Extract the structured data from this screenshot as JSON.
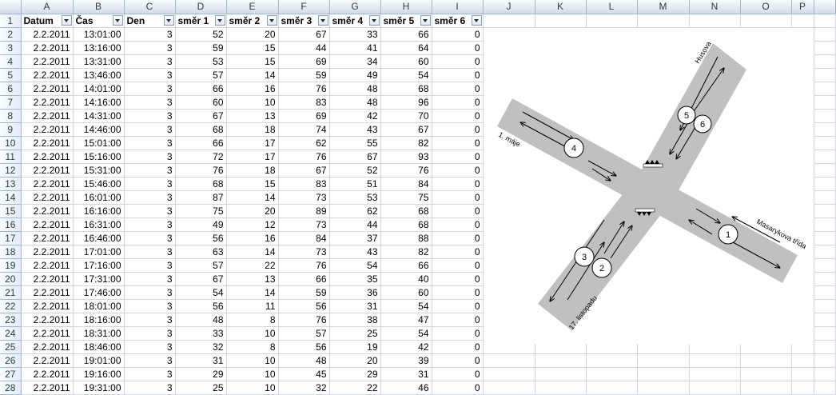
{
  "columns": [
    "A",
    "B",
    "C",
    "D",
    "E",
    "F",
    "G",
    "H",
    "I",
    "J",
    "K",
    "L",
    "M",
    "N",
    "O",
    "P"
  ],
  "headers": [
    "Datum",
    "Čas",
    "Den",
    "směr 1",
    "směr 2",
    "směr 3",
    "směr 4",
    "směr 5",
    "směr 6"
  ],
  "rows": [
    [
      "2.2.2011",
      "13:01:00",
      "3",
      "52",
      "20",
      "67",
      "33",
      "66",
      "0"
    ],
    [
      "2.2.2011",
      "13:16:00",
      "3",
      "59",
      "15",
      "44",
      "41",
      "64",
      "0"
    ],
    [
      "2.2.2011",
      "13:31:00",
      "3",
      "53",
      "15",
      "69",
      "34",
      "60",
      "0"
    ],
    [
      "2.2.2011",
      "13:46:00",
      "3",
      "57",
      "14",
      "59",
      "49",
      "54",
      "0"
    ],
    [
      "2.2.2011",
      "14:01:00",
      "3",
      "66",
      "16",
      "76",
      "48",
      "68",
      "0"
    ],
    [
      "2.2.2011",
      "14:16:00",
      "3",
      "60",
      "10",
      "83",
      "48",
      "96",
      "0"
    ],
    [
      "2.2.2011",
      "14:31:00",
      "3",
      "67",
      "13",
      "69",
      "42",
      "70",
      "0"
    ],
    [
      "2.2.2011",
      "14:46:00",
      "3",
      "68",
      "18",
      "74",
      "43",
      "67",
      "0"
    ],
    [
      "2.2.2011",
      "15:01:00",
      "3",
      "66",
      "17",
      "62",
      "55",
      "82",
      "0"
    ],
    [
      "2.2.2011",
      "15:16:00",
      "3",
      "72",
      "17",
      "76",
      "67",
      "93",
      "0"
    ],
    [
      "2.2.2011",
      "15:31:00",
      "3",
      "76",
      "18",
      "67",
      "52",
      "76",
      "0"
    ],
    [
      "2.2.2011",
      "15:46:00",
      "3",
      "68",
      "15",
      "83",
      "51",
      "84",
      "0"
    ],
    [
      "2.2.2011",
      "16:01:00",
      "3",
      "87",
      "14",
      "73",
      "53",
      "75",
      "0"
    ],
    [
      "2.2.2011",
      "16:16:00",
      "3",
      "75",
      "20",
      "89",
      "62",
      "68",
      "0"
    ],
    [
      "2.2.2011",
      "16:31:00",
      "3",
      "49",
      "12",
      "73",
      "44",
      "68",
      "0"
    ],
    [
      "2.2.2011",
      "16:46:00",
      "3",
      "56",
      "16",
      "84",
      "37",
      "88",
      "0"
    ],
    [
      "2.2.2011",
      "17:01:00",
      "3",
      "63",
      "14",
      "73",
      "43",
      "82",
      "0"
    ],
    [
      "2.2.2011",
      "17:16:00",
      "3",
      "57",
      "22",
      "76",
      "54",
      "66",
      "0"
    ],
    [
      "2.2.2011",
      "17:31:00",
      "3",
      "67",
      "13",
      "66",
      "35",
      "40",
      "0"
    ],
    [
      "2.2.2011",
      "17:46:00",
      "3",
      "54",
      "14",
      "59",
      "36",
      "60",
      "0"
    ],
    [
      "2.2.2011",
      "18:01:00",
      "3",
      "56",
      "11",
      "56",
      "31",
      "54",
      "0"
    ],
    [
      "2.2.2011",
      "18:16:00",
      "3",
      "48",
      "8",
      "76",
      "38",
      "47",
      "0"
    ],
    [
      "2.2.2011",
      "18:31:00",
      "3",
      "33",
      "10",
      "57",
      "25",
      "54",
      "0"
    ],
    [
      "2.2.2011",
      "18:46:00",
      "3",
      "32",
      "8",
      "56",
      "19",
      "42",
      "0"
    ],
    [
      "2.2.2011",
      "19:01:00",
      "3",
      "31",
      "10",
      "48",
      "20",
      "39",
      "0"
    ],
    [
      "2.2.2011",
      "19:16:00",
      "3",
      "29",
      "10",
      "45",
      "29",
      "31",
      "0"
    ],
    [
      "2.2.2011",
      "19:31:00",
      "3",
      "25",
      "10",
      "32",
      "22",
      "46",
      "0"
    ]
  ],
  "diagram": {
    "streets": {
      "top": "Husova",
      "left": "1. máje",
      "right": "Masarykova třída",
      "bottom": "17. listopadu"
    },
    "directions": [
      "1",
      "2",
      "3",
      "4",
      "5",
      "6"
    ],
    "colors": {
      "road": "#c0c0c0",
      "line": "#000000"
    }
  }
}
